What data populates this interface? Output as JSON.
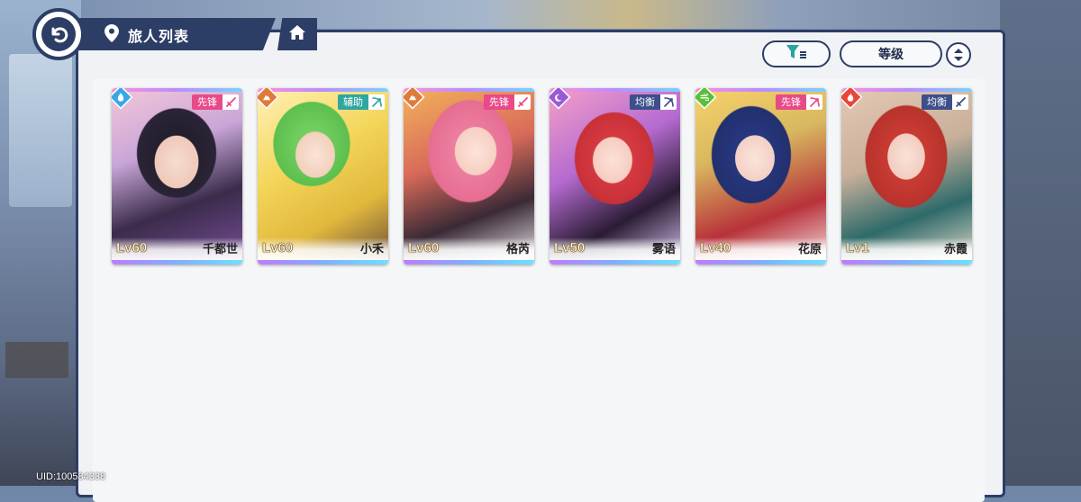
{
  "header": {
    "title": "旅人列表",
    "back_icon": "back-arrow-icon",
    "home_icon": "home-icon"
  },
  "toolbar": {
    "filter_icon": "filter-icon",
    "sort_label": "等级",
    "order_icon": "sort-order-icon"
  },
  "characters": [
    {
      "name": "千都世",
      "level": "Lv60",
      "role": "先锋",
      "element": "water",
      "weapon": "sword-icon"
    },
    {
      "name": "小禾",
      "level": "Lv60",
      "role": "辅助",
      "element": "earth",
      "weapon": "bow-icon"
    },
    {
      "name": "格芮",
      "level": "Lv60",
      "role": "先锋",
      "element": "earth",
      "weapon": "sword-icon"
    },
    {
      "name": "雾语",
      "level": "Lv50",
      "role": "均衡",
      "element": "dark",
      "weapon": "bow-icon"
    },
    {
      "name": "花原",
      "level": "Lv40",
      "role": "先锋",
      "element": "wind",
      "weapon": "bow-icon"
    },
    {
      "name": "赤霞",
      "level": "Lv1",
      "role": "均衡",
      "element": "fire",
      "weapon": "sword-icon"
    }
  ],
  "footer": {
    "uid": "UID:100584338"
  },
  "colors": {
    "navy": "#2c3d66",
    "vanguard": "#e84a88",
    "support": "#2fa6a0",
    "balance": "#3c4f8a"
  }
}
